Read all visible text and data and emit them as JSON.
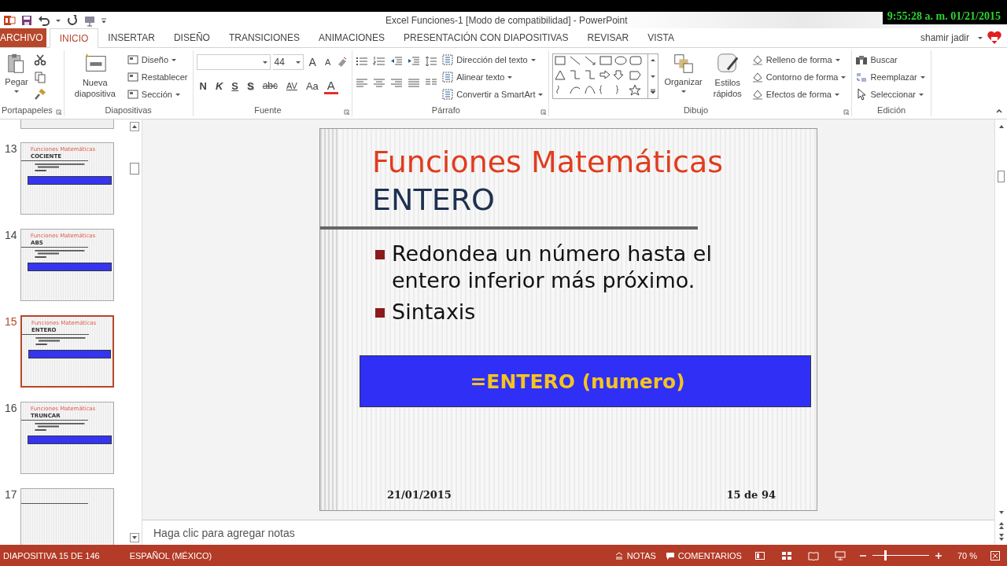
{
  "window": {
    "title": "Excel Funciones-1 [Modo de compatibilidad] - PowerPoint",
    "clock": "9:55:28 a. m. 01/21/2015",
    "user": "shamir jadir"
  },
  "tabs": [
    {
      "label": "ARCHIVO",
      "kind": "file",
      "selected": false
    },
    {
      "label": "INICIO",
      "kind": "tab",
      "selected": true
    },
    {
      "label": "INSERTAR",
      "kind": "tab",
      "selected": false
    },
    {
      "label": "DISEÑO",
      "kind": "tab",
      "selected": false
    },
    {
      "label": "TRANSICIONES",
      "kind": "tab",
      "selected": false
    },
    {
      "label": "ANIMACIONES",
      "kind": "tab",
      "selected": false
    },
    {
      "label": "PRESENTACIÓN CON DIAPOSITIVAS",
      "kind": "tab",
      "selected": false
    },
    {
      "label": "REVISAR",
      "kind": "tab",
      "selected": false
    },
    {
      "label": "VISTA",
      "kind": "tab",
      "selected": false
    }
  ],
  "ribbon": {
    "clipboard": {
      "name": "Portapapeles",
      "paste": "Pegar"
    },
    "slides": {
      "name": "Diapositivas",
      "new_slide": "Nueva diapositiva",
      "commands": [
        "Diseño",
        "Restablecer",
        "Sección"
      ]
    },
    "font": {
      "name": "Fuente",
      "size": "44",
      "size_buttons": [
        "A",
        "A"
      ],
      "format_buttons": [
        "N",
        "K",
        "S",
        "S",
        "abc",
        "AV",
        "Aa",
        "A"
      ]
    },
    "paragraph": {
      "name": "Párrafo",
      "commands": [
        "Dirección del texto",
        "Alinear texto",
        "Convertir a SmartArt"
      ]
    },
    "drawing": {
      "name": "Dibujo",
      "arrange": "Organizar",
      "quick_styles": "Estilos rápidos",
      "commands": [
        "Relleno de forma",
        "Contorno de forma",
        "Efectos de forma"
      ]
    },
    "editing": {
      "name": "Edición",
      "commands": [
        "Buscar",
        "Reemplazar",
        "Seleccionar"
      ]
    }
  },
  "thumbnails": [
    {
      "number": "13",
      "title": "Funciones Matemáticas",
      "subtitle": "COCIENTE",
      "kind": "formula",
      "selected": false
    },
    {
      "number": "14",
      "title": "Funciones Matemáticas",
      "subtitle": "ABS",
      "kind": "formula",
      "selected": false
    },
    {
      "number": "15",
      "title": "Funciones Matemáticas",
      "subtitle": "ENTERO",
      "kind": "formula",
      "selected": true
    },
    {
      "number": "16",
      "title": "Funciones Matemáticas",
      "subtitle": "TRUNCAR",
      "kind": "formula",
      "selected": false
    },
    {
      "number": "17",
      "kind": "blank",
      "selected": false
    }
  ],
  "slide": {
    "title": "Funciones Matemáticas",
    "subtitle": "ENTERO",
    "bullets": [
      "Redondea un número hasta el entero inferior más próximo.",
      "Sintaxis"
    ],
    "formula": "=ENTERO (numero)",
    "date": "21/01/2015",
    "page": "15 de 94"
  },
  "notes": {
    "placeholder": "Haga clic para agregar notas"
  },
  "status_bar": {
    "slide": "DIAPOSITIVA 15 DE 146",
    "language": "ESPAÑOL (MÉXICO)",
    "notes": "NOTAS",
    "comments": "COMENTARIOS",
    "zoom": {
      "level": 0.23,
      "reading": "70 %"
    }
  }
}
